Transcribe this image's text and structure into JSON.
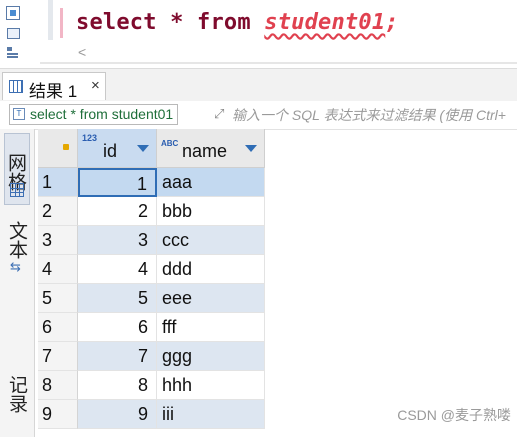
{
  "editor": {
    "sql_keyword_select": "select",
    "sql_star": "*",
    "sql_keyword_from": "from",
    "sql_table": "student01",
    "sql_semicolon": ";",
    "scroll_left": "<"
  },
  "results_tab": {
    "label": "结果 1",
    "close": "×"
  },
  "filter": {
    "query": "select * from student01",
    "placeholder": "输入一个 SQL 表达式来过滤结果 (使用 Ctrl+"
  },
  "side_panel": {
    "grid": "网格",
    "text": "文本",
    "record": "记录"
  },
  "grid": {
    "columns": [
      {
        "name": "id",
        "type": "123"
      },
      {
        "name": "name",
        "type": "ABC"
      }
    ],
    "rows": [
      {
        "num": "1",
        "id": "1",
        "name": "aaa"
      },
      {
        "num": "2",
        "id": "2",
        "name": "bbb"
      },
      {
        "num": "3",
        "id": "3",
        "name": "ccc"
      },
      {
        "num": "4",
        "id": "4",
        "name": "ddd"
      },
      {
        "num": "5",
        "id": "5",
        "name": "eee"
      },
      {
        "num": "6",
        "id": "6",
        "name": "fff"
      },
      {
        "num": "7",
        "id": "7",
        "name": "ggg"
      },
      {
        "num": "8",
        "id": "8",
        "name": "hhh"
      },
      {
        "num": "9",
        "id": "9",
        "name": "iii"
      }
    ],
    "selected_row": "1"
  },
  "watermark": "CSDN @麦子熟喽",
  "colors": {
    "keyword": "#7f0b2d",
    "error": "#e0414f",
    "selection": "#c3d9f0",
    "stripe": "#dde6f1",
    "accent": "#2f6db5"
  }
}
